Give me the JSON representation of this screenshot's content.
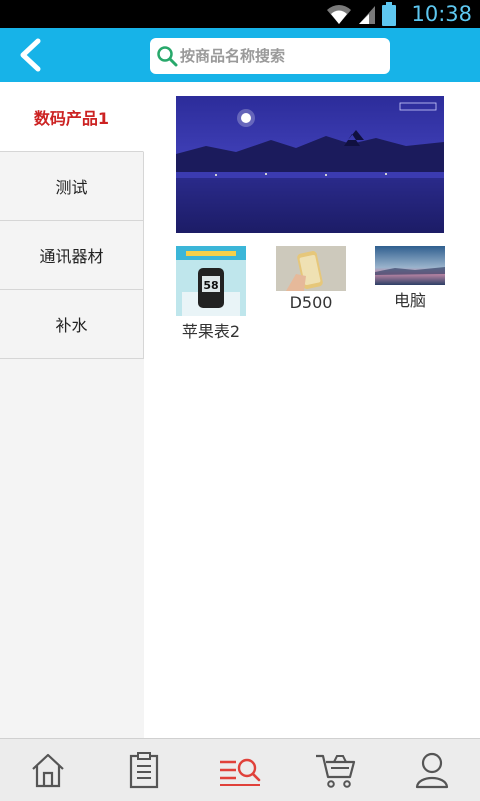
{
  "status_bar": {
    "time": "10:38"
  },
  "header": {
    "search_placeholder": "按商品名称搜索"
  },
  "sidebar": {
    "items": [
      {
        "label": "数码产品1",
        "active": true
      },
      {
        "label": "测试",
        "active": false
      },
      {
        "label": "通讯器材",
        "active": false
      },
      {
        "label": "补水",
        "active": false
      }
    ]
  },
  "products": [
    {
      "label": "苹果表2",
      "thumb_text": "58"
    },
    {
      "label": "D500"
    },
    {
      "label": "电脑"
    }
  ],
  "bottom_nav": {
    "items": [
      "home-icon",
      "clipboard-icon",
      "category-search-icon",
      "cart-icon",
      "user-icon"
    ],
    "active_index": 2
  },
  "colors": {
    "accent": "#17b3e8",
    "active_text": "#cc2222",
    "nav_active": "#e0413a"
  }
}
